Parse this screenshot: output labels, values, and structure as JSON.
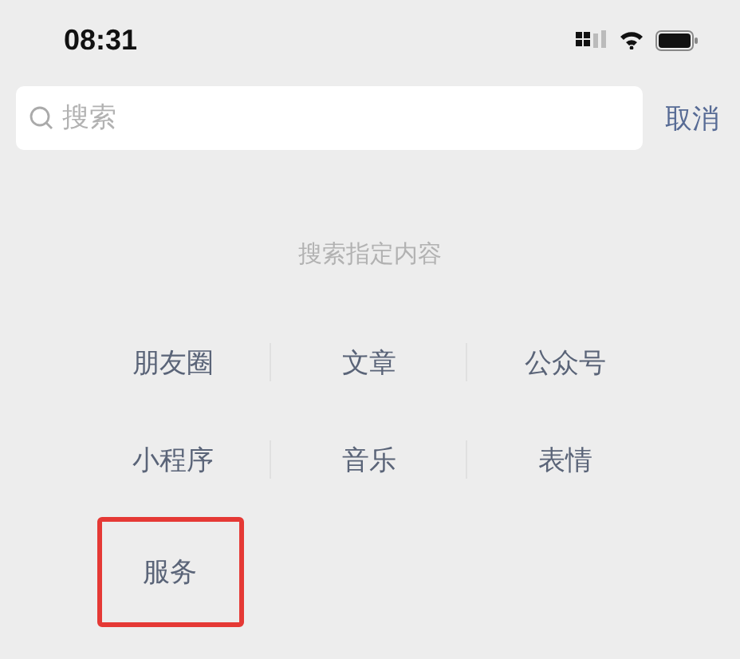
{
  "status_bar": {
    "time": "08:31"
  },
  "search": {
    "placeholder": "搜索",
    "cancel": "取消"
  },
  "hint": "搜索指定内容",
  "categories": [
    {
      "label": "朋友圈",
      "highlighted": false
    },
    {
      "label": "文章",
      "highlighted": false
    },
    {
      "label": "公众号",
      "highlighted": false
    },
    {
      "label": "小程序",
      "highlighted": false
    },
    {
      "label": "音乐",
      "highlighted": false
    },
    {
      "label": "表情",
      "highlighted": false
    },
    {
      "label": "服务",
      "highlighted": true
    }
  ]
}
